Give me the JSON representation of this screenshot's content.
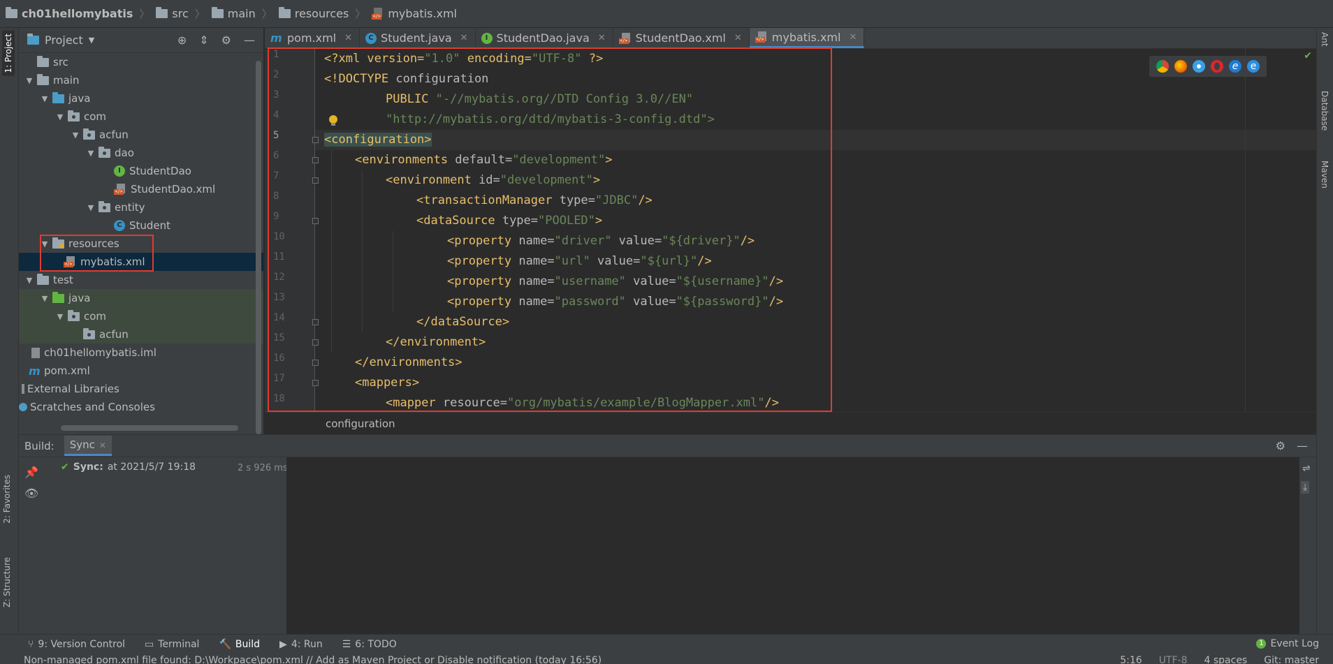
{
  "breadcrumb": {
    "project": "ch01hellomybatis",
    "items": [
      "src",
      "main",
      "resources",
      "mybatis.xml"
    ]
  },
  "side_tabs": {
    "left": [
      "1: Project",
      "2: Favorites",
      "Z: Structure"
    ],
    "right": [
      "Ant",
      "Database",
      "Maven"
    ]
  },
  "project_panel": {
    "title": "Project",
    "tree": [
      {
        "label": "src",
        "icon": "folder-icon"
      },
      {
        "label": "main",
        "icon": "folder-icon"
      },
      {
        "label": "java",
        "icon": "source-folder-icon"
      },
      {
        "label": "com",
        "icon": "package-icon"
      },
      {
        "label": "acfun",
        "icon": "package-icon"
      },
      {
        "label": "dao",
        "icon": "package-icon"
      },
      {
        "label": "StudentDao",
        "icon": "interface-icon"
      },
      {
        "label": "StudentDao.xml",
        "icon": "xml-file-icon"
      },
      {
        "label": "entity",
        "icon": "package-icon"
      },
      {
        "label": "Student",
        "icon": "class-icon"
      },
      {
        "label": "resources",
        "icon": "resources-folder-icon"
      },
      {
        "label": "mybatis.xml",
        "icon": "xml-file-icon"
      },
      {
        "label": "test",
        "icon": "folder-icon"
      },
      {
        "label": "java",
        "icon": "test-folder-icon"
      },
      {
        "label": "com",
        "icon": "package-icon"
      },
      {
        "label": "acfun",
        "icon": "package-icon"
      },
      {
        "label": "ch01hellomybatis.iml",
        "icon": "iml-file-icon"
      },
      {
        "label": "pom.xml",
        "icon": "maven-icon"
      },
      {
        "label": "External Libraries",
        "icon": "library-icon"
      },
      {
        "label": "Scratches and Consoles",
        "icon": "scratches-icon"
      }
    ]
  },
  "editor_tabs": [
    {
      "label": "pom.xml",
      "icon": "maven-icon"
    },
    {
      "label": "Student.java",
      "icon": "class-icon"
    },
    {
      "label": "StudentDao.java",
      "icon": "interface-icon"
    },
    {
      "label": "StudentDao.xml",
      "icon": "xml-file-icon"
    },
    {
      "label": "mybatis.xml",
      "icon": "xml-file-icon",
      "active": true
    }
  ],
  "editor": {
    "line_numbers": [
      "1",
      "2",
      "3",
      "4",
      "5",
      "6",
      "7",
      "8",
      "9",
      "10",
      "11",
      "12",
      "13",
      "14",
      "15",
      "16",
      "17",
      "18"
    ],
    "current_line": "5",
    "code": {
      "l1a": "<?xml version=",
      "l1b": "\"1.0\"",
      "l1c": " encoding=",
      "l1d": "\"UTF-8\"",
      "l1e": " ?>",
      "l2a": "<!DOCTYPE",
      "l2b": " configuration",
      "l3a": "PUBLIC ",
      "l3b": "\"-//mybatis.org//DTD Config 3.0//EN\"",
      "l4": "\"http://mybatis.org/dtd/mybatis-3-config.dtd\">",
      "l5": "<configuration>",
      "l6a": "<environments",
      "l6b": " default=",
      "l6c": "\"development\"",
      "l6d": ">",
      "l7a": "<environment",
      "l7b": " id=",
      "l7c": "\"development\"",
      "l7d": ">",
      "l8a": "<transactionManager",
      "l8b": " type=",
      "l8c": "\"JDBC\"",
      "l8d": "/>",
      "l9a": "<dataSource",
      "l9b": " type=",
      "l9c": "\"POOLED\"",
      "l9d": ">",
      "l10a": "<property",
      "l10b": " name=",
      "l10c": "\"driver\"",
      "l10d": " value=",
      "l10e": "\"${driver}\"",
      "l10f": "/>",
      "l11a": "<property",
      "l11b": " name=",
      "l11c": "\"url\"",
      "l11d": " value=",
      "l11e": "\"${url}\"",
      "l11f": "/>",
      "l12a": "<property",
      "l12b": " name=",
      "l12c": "\"username\"",
      "l12d": " value=",
      "l12e": "\"${username}\"",
      "l12f": "/>",
      "l13a": "<property",
      "l13b": " name=",
      "l13c": "\"password\"",
      "l13d": " value=",
      "l13e": "\"${password}\"",
      "l13f": "/>",
      "l14": "</dataSource>",
      "l15": "</environment>",
      "l16": "</environments>",
      "l17": "<mappers>",
      "l18a": "<mapper",
      "l18b": " resource=",
      "l18c": "\"org/mybatis/example/BlogMapper.xml\"",
      "l18d": "/>"
    },
    "breadcrumb": "configuration"
  },
  "build_panel": {
    "title": "Build:",
    "tab": "Sync",
    "sync_label": "Sync:",
    "sync_text": "at 2021/5/7 19:18",
    "duration": "2 s 926 ms"
  },
  "bottom_tabs": [
    {
      "label": "6: TODO",
      "icon": "todo-icon"
    }
  ],
  "bottom": {
    "version_control": "9: Version Control",
    "terminal": "Terminal",
    "build": "Build",
    "run": "4: Run",
    "todo": "6: TODO",
    "event_log": "Event Log",
    "event_count": "1"
  },
  "status_bar": {
    "message": "Non-managed pom.xml file found: D:\\Workpace\\pom.xml // Add as Maven Project or Disable notification (today 16:56)",
    "position": "5:16",
    "encoding": "UTF-8",
    "indent": "4 spaces",
    "vcs": "Git: master"
  },
  "colors": {
    "highlight_box": "#e03c31",
    "selection": "#0d293e",
    "xml_tag": "#e8bf6a",
    "xml_value": "#6a8759"
  }
}
